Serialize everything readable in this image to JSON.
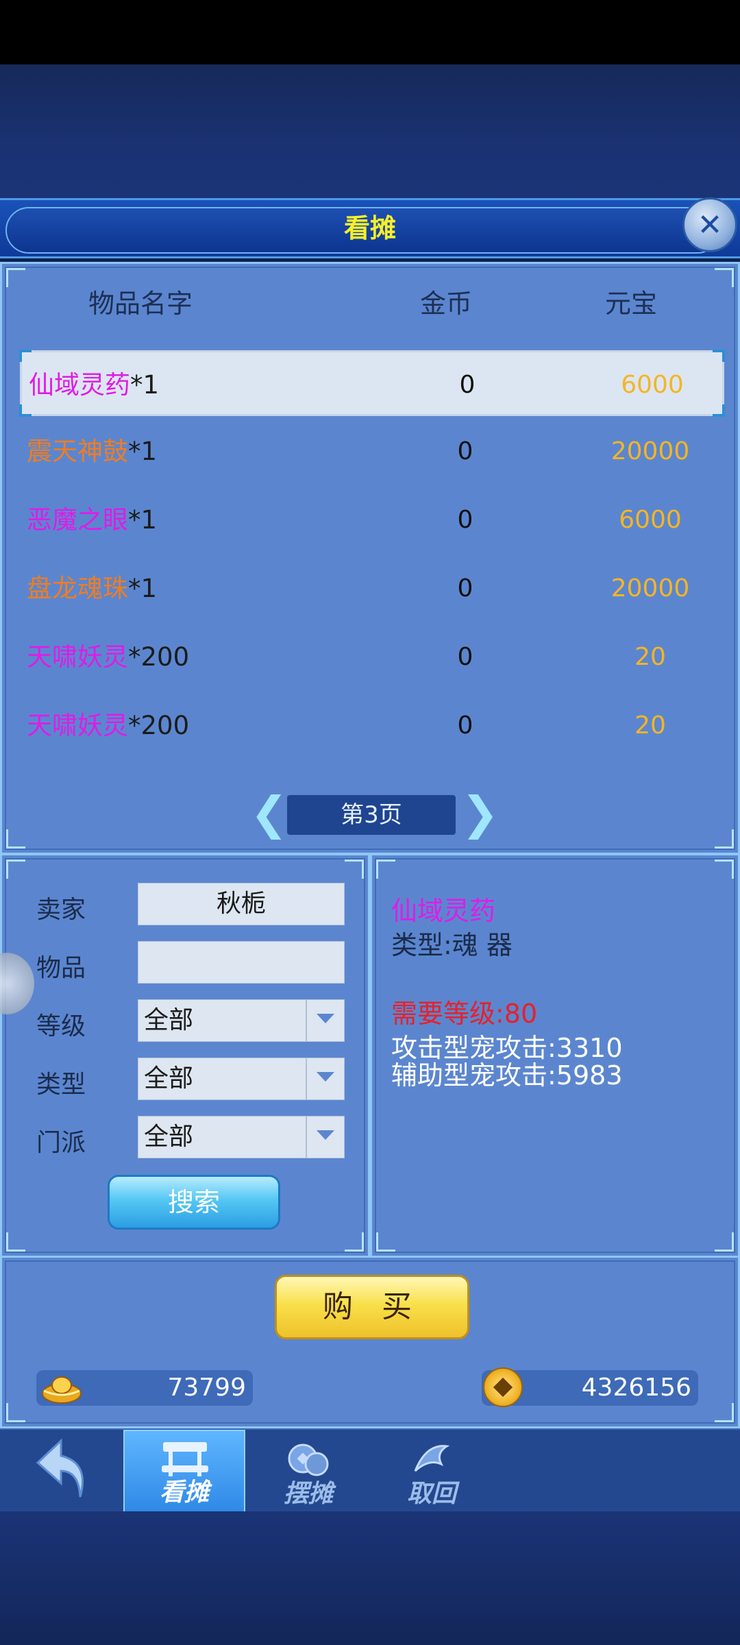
{
  "title": "看摊",
  "columns": {
    "name": "物品名字",
    "gold": "金币",
    "yuanbao": "元宝"
  },
  "items": [
    {
      "name": "仙域灵药",
      "qty": "*1",
      "gold": "0",
      "yuanbao": "6000",
      "color": "#e21ae8"
    },
    {
      "name": "震天神鼓",
      "qty": "*1",
      "gold": "0",
      "yuanbao": "20000",
      "color": "#ef7d22"
    },
    {
      "name": "恶魔之眼",
      "qty": "*1",
      "gold": "0",
      "yuanbao": "6000",
      "color": "#e21ae8"
    },
    {
      "name": "盘龙魂珠",
      "qty": "*1",
      "gold": "0",
      "yuanbao": "20000",
      "color": "#ef7d22"
    },
    {
      "name": "天啸妖灵",
      "qty": "*200",
      "gold": "0",
      "yuanbao": "20",
      "color": "#e21ae8"
    },
    {
      "name": "天啸妖灵",
      "qty": "*200",
      "gold": "0",
      "yuanbao": "20",
      "color": "#e21ae8"
    }
  ],
  "pager": {
    "page_label": "第3页"
  },
  "search": {
    "seller_label": "卖家",
    "seller_value": "秋栀",
    "item_label": "物品",
    "item_value": "",
    "level_label": "等级",
    "level_value": "全部",
    "type_label": "类型",
    "type_value": "全部",
    "school_label": "门派",
    "school_value": "全部",
    "button": "搜索"
  },
  "detail": {
    "name": "仙域灵药",
    "type": "类型:魂 器",
    "required_level": "需要等级:80",
    "attack_pet": "攻击型宠攻击:3310",
    "support_pet": "辅助型宠攻击:5983"
  },
  "buy_button": "购 买",
  "currency": {
    "yuanbao": "73799",
    "gold": "4326156"
  },
  "nav": {
    "kantan": "看摊",
    "baitan": "摆摊",
    "quhui": "取回"
  },
  "icons": [
    "close-icon",
    "back-arrow-icon",
    "stall-icon",
    "coins-icon",
    "retrieve-icon",
    "ingot-icon",
    "coin-icon",
    "dropdown-arrow-icon"
  ]
}
